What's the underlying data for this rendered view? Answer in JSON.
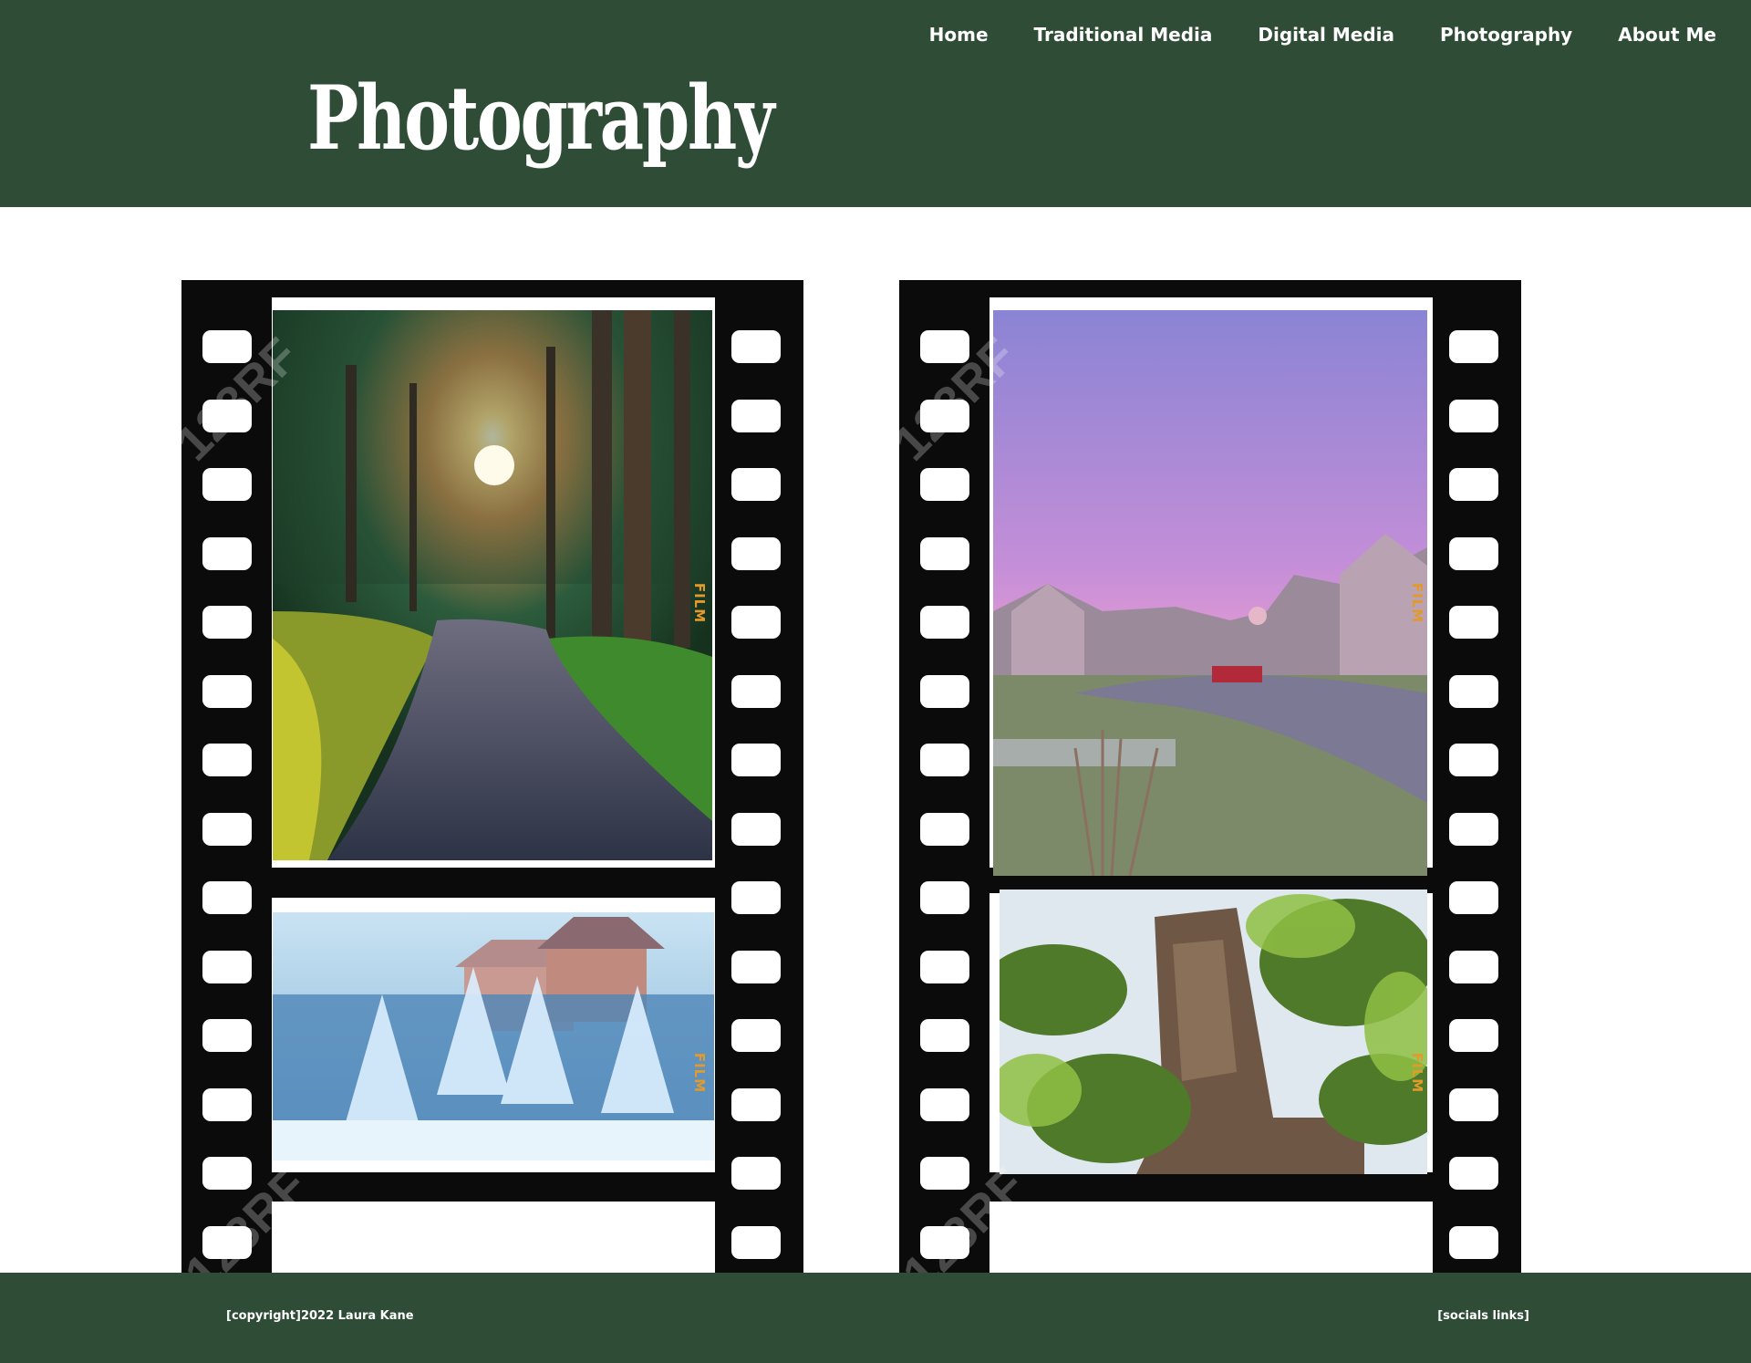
{
  "nav": {
    "items": [
      {
        "label": "Home"
      },
      {
        "label": "Traditional Media"
      },
      {
        "label": "Digital Media"
      },
      {
        "label": "Photography"
      },
      {
        "label": "About Me"
      }
    ]
  },
  "header": {
    "title": "Photography"
  },
  "gallery": {
    "film_label": "FILM",
    "watermark": "123RF"
  },
  "footer": {
    "copyright": "[copyright]2022 Laura Kane",
    "socials": "[socials links]"
  },
  "colors": {
    "header_bg": "#2f4c36",
    "film_black": "#0b0b0b",
    "film_label": "#e39a2a"
  }
}
